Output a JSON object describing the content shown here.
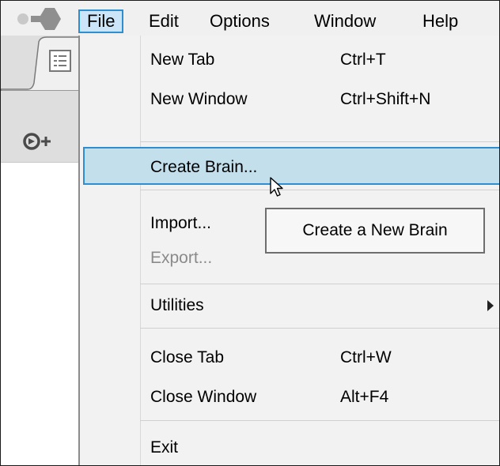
{
  "menubar": {
    "logo_icon": "app-logo-icon",
    "items": [
      {
        "label": "File",
        "active": true
      },
      {
        "label": "Edit"
      },
      {
        "label": "Options"
      },
      {
        "label": "Window"
      },
      {
        "label": "Help"
      }
    ]
  },
  "left_panel": {
    "tab_icon": "list-icon",
    "add_icon": "new-brain-icon"
  },
  "file_menu": {
    "new_tab": {
      "label": "New Tab",
      "shortcut": "Ctrl+T"
    },
    "new_window": {
      "label": "New Window",
      "shortcut": "Ctrl+Shift+N"
    },
    "create_brain": {
      "label": "Create Brain...",
      "highlighted": true
    },
    "import": {
      "label": "Import..."
    },
    "export": {
      "label": "Export...",
      "disabled": true
    },
    "utilities": {
      "label": "Utilities",
      "has_submenu": true
    },
    "close_tab": {
      "label": "Close Tab",
      "shortcut": "Ctrl+W"
    },
    "close_window": {
      "label": "Close Window",
      "shortcut": "Alt+F4"
    },
    "exit": {
      "label": "Exit"
    }
  },
  "tooltip": {
    "text": "Create a New Brain"
  },
  "colors": {
    "menu_highlight": "#c4dfec",
    "accent_border": "#2e8fd0",
    "file_active_bg": "#cce4f7",
    "menubar_bg": "#f0f0f0",
    "dropdown_bg": "#f2f2f2",
    "disabled_text": "#8a8a8a"
  }
}
